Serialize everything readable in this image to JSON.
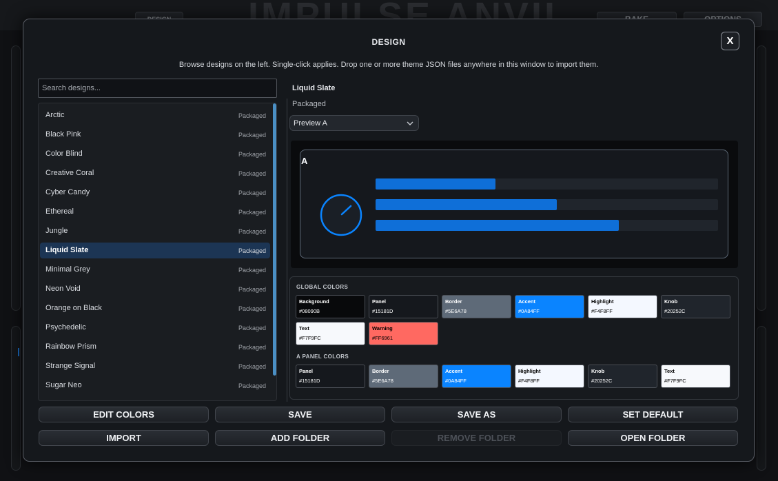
{
  "background_app": {
    "title": "IMPULSE ANVIL",
    "buttons": [
      "BAKE",
      "OPTIONS",
      "DESIGN"
    ]
  },
  "modal": {
    "title": "DESIGN",
    "close_label": "X",
    "description": "Browse designs on the left. Single-click applies. Drop one or more theme JSON files anywhere in this window to import them.",
    "search": {
      "placeholder": "Search designs...",
      "value": ""
    }
  },
  "design_list": [
    {
      "name": "Arctic",
      "tag": "Packaged"
    },
    {
      "name": "Black Pink",
      "tag": "Packaged"
    },
    {
      "name": "Color Blind",
      "tag": "Packaged"
    },
    {
      "name": "Creative Coral",
      "tag": "Packaged"
    },
    {
      "name": "Cyber Candy",
      "tag": "Packaged"
    },
    {
      "name": "Ethereal",
      "tag": "Packaged"
    },
    {
      "name": "Jungle",
      "tag": "Packaged"
    },
    {
      "name": "Liquid Slate",
      "tag": "Packaged",
      "selected": true
    },
    {
      "name": "Minimal Grey",
      "tag": "Packaged"
    },
    {
      "name": "Neon Void",
      "tag": "Packaged"
    },
    {
      "name": "Orange on Black",
      "tag": "Packaged"
    },
    {
      "name": "Psychedelic",
      "tag": "Packaged"
    },
    {
      "name": "Rainbow Prism",
      "tag": "Packaged"
    },
    {
      "name": "Strange Signal",
      "tag": "Packaged"
    },
    {
      "name": "Sugar Neo",
      "tag": "Packaged"
    }
  ],
  "selected_design": {
    "name": "Liquid Slate",
    "source": "Packaged",
    "preview_select": {
      "value": "Preview A",
      "icon": "chevron-down-icon"
    }
  },
  "preview": {
    "panel_letter": "A",
    "knob": {
      "icon": "knob-icon"
    },
    "bars": [
      0.35,
      0.53,
      0.71
    ]
  },
  "global_colors": {
    "label": "GLOBAL COLORS",
    "swatches": [
      {
        "name": "Background",
        "hex": "#08090B",
        "text": "#FFFFFF"
      },
      {
        "name": "Panel",
        "hex": "#15181D",
        "text": "#FFFFFF"
      },
      {
        "name": "Border",
        "hex": "#5E6A78",
        "text": "#FFFFFF"
      },
      {
        "name": "Accent",
        "hex": "#0A84FF",
        "text": "#FFFFFF"
      },
      {
        "name": "Highlight",
        "hex": "#F4F8FF",
        "text": "#000000"
      },
      {
        "name": "Knob",
        "hex": "#20252C",
        "text": "#FFFFFF"
      },
      {
        "name": "Text",
        "hex": "#F7F9FC",
        "text": "#000000"
      },
      {
        "name": "Warning",
        "hex": "#FF6961",
        "text": "#000000"
      }
    ]
  },
  "panel_colors": {
    "label": "A PANEL COLORS",
    "swatches": [
      {
        "name": "Panel",
        "hex": "#15181D",
        "text": "#FFFFFF"
      },
      {
        "name": "Border",
        "hex": "#5E6A78",
        "text": "#FFFFFF"
      },
      {
        "name": "Accent",
        "hex": "#0A84FF",
        "text": "#FFFFFF"
      },
      {
        "name": "Highlight",
        "hex": "#F4F8FF",
        "text": "#000000"
      },
      {
        "name": "Knob",
        "hex": "#20252C",
        "text": "#FFFFFF"
      },
      {
        "name": "Text",
        "hex": "#F7F9FC",
        "text": "#000000"
      }
    ]
  },
  "footer": {
    "edit_colors": "EDIT COLORS",
    "save": "SAVE",
    "save_as": "SAVE AS",
    "set_default": "SET DEFAULT",
    "import": "IMPORT",
    "add_folder": "ADD FOLDER",
    "remove_folder": "REMOVE FOLDER",
    "open_folder": "OPEN FOLDER"
  },
  "colors": {
    "accent": "#0A84FF",
    "selected_row": "#1C3554",
    "scrollbar": "#4A8FC4"
  }
}
